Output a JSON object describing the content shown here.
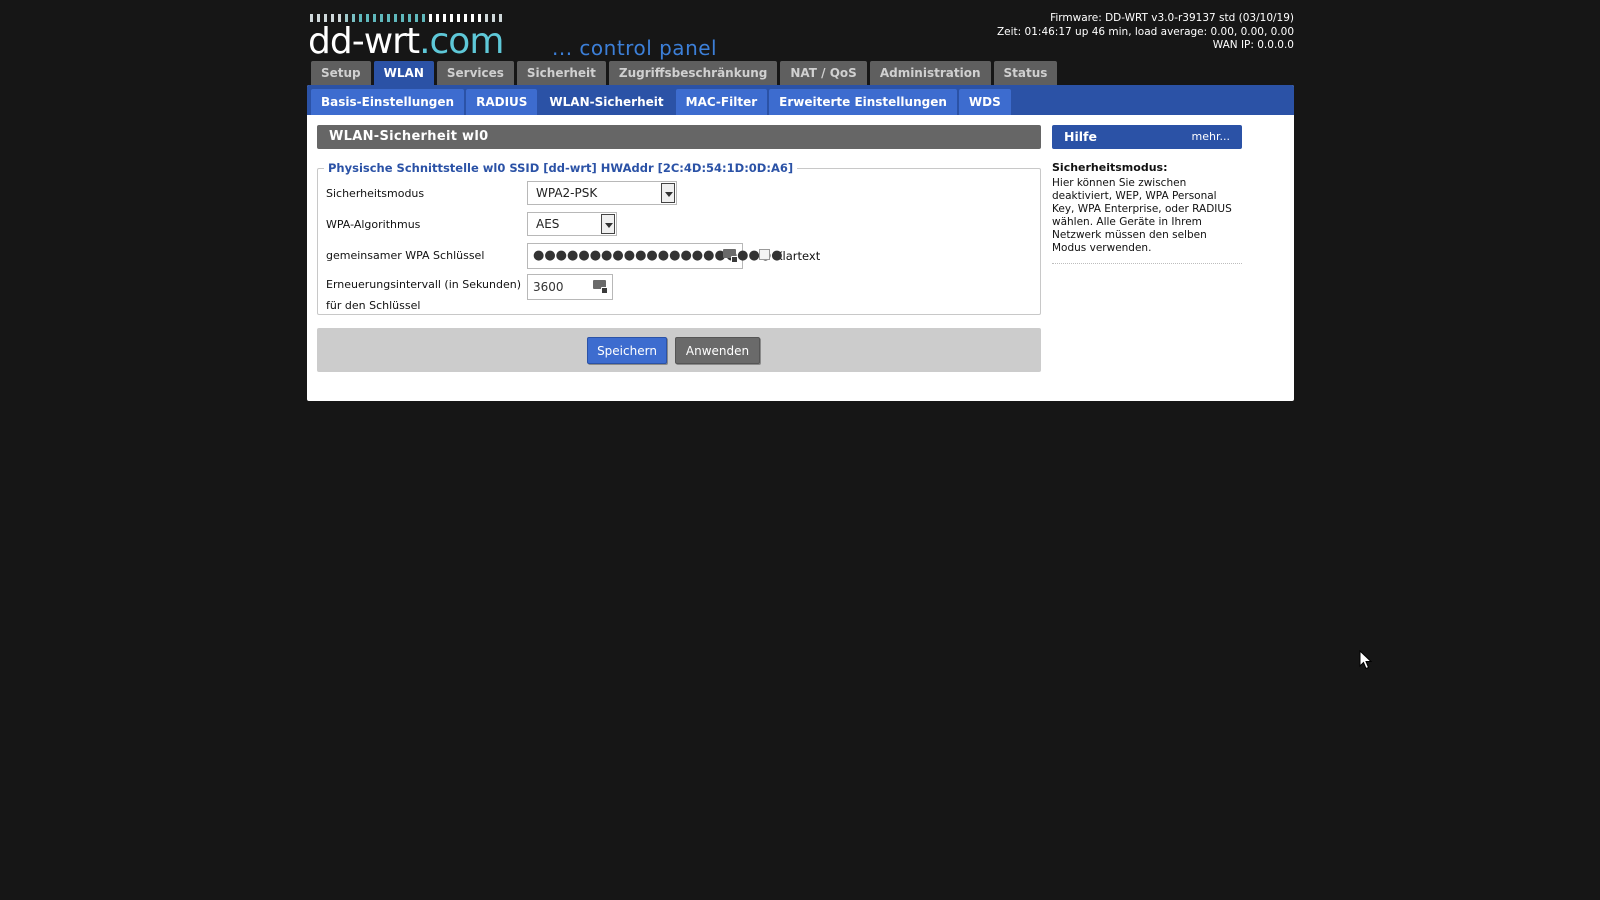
{
  "header": {
    "logo_main": "dd-wrt",
    "logo_suffix": ".com",
    "logo_tagline": "... control panel",
    "firmware": "Firmware: DD-WRT v3.0-r39137 std (03/10/19)",
    "time": "Zeit: 01:46:17 up 46 min, load average: 0.00, 0.00, 0.00",
    "wan_ip": "WAN IP: 0.0.0.0"
  },
  "main_tabs": [
    {
      "label": "Setup"
    },
    {
      "label": "WLAN",
      "active": true
    },
    {
      "label": "Services"
    },
    {
      "label": "Sicherheit"
    },
    {
      "label": "Zugriffsbeschränkung"
    },
    {
      "label": "NAT / QoS"
    },
    {
      "label": "Administration"
    },
    {
      "label": "Status"
    }
  ],
  "sub_tabs": [
    {
      "label": "Basis-Einstellungen"
    },
    {
      "label": "RADIUS"
    },
    {
      "label": "WLAN-Sicherheit",
      "active": true
    },
    {
      "label": "MAC-Filter"
    },
    {
      "label": "Erweiterte Einstellungen"
    },
    {
      "label": "WDS"
    }
  ],
  "section": {
    "title": "WLAN-Sicherheit wl0",
    "legend": "Physische Schnittstelle wl0 SSID [dd-wrt] HWAddr [2C:4D:54:1D:0D:A6]",
    "security_mode": {
      "label": "Sicherheitsmodus",
      "value": "WPA2-PSK"
    },
    "wpa_algorithm": {
      "label": "WPA-Algorithmus",
      "value": "AES"
    },
    "wpa_key": {
      "label": "gemeinsamer WPA Schlüssel",
      "value": "●●●●●●●●●●●●●●●●●●●●●●",
      "cleartext_label": "Klartext"
    },
    "rekey_interval": {
      "label": "Erneuerungsintervall (in Sekunden) für den Schlüssel",
      "value": "3600"
    }
  },
  "buttons": {
    "save": "Speichern",
    "apply": "Anwenden"
  },
  "help": {
    "title": "Hilfe",
    "more": "mehr...",
    "heading": "Sicherheitsmodus:",
    "text": "Hier können Sie zwischen deaktiviert, WEP, WPA Personal Key, WPA Enterprise, oder RADIUS wählen. Alle Geräte in Ihrem Netzwerk müssen den selben Modus verwenden."
  },
  "colors": {
    "accent": "#2b52a6",
    "tab_inactive": "#5f5f5f",
    "background": "#161616"
  }
}
